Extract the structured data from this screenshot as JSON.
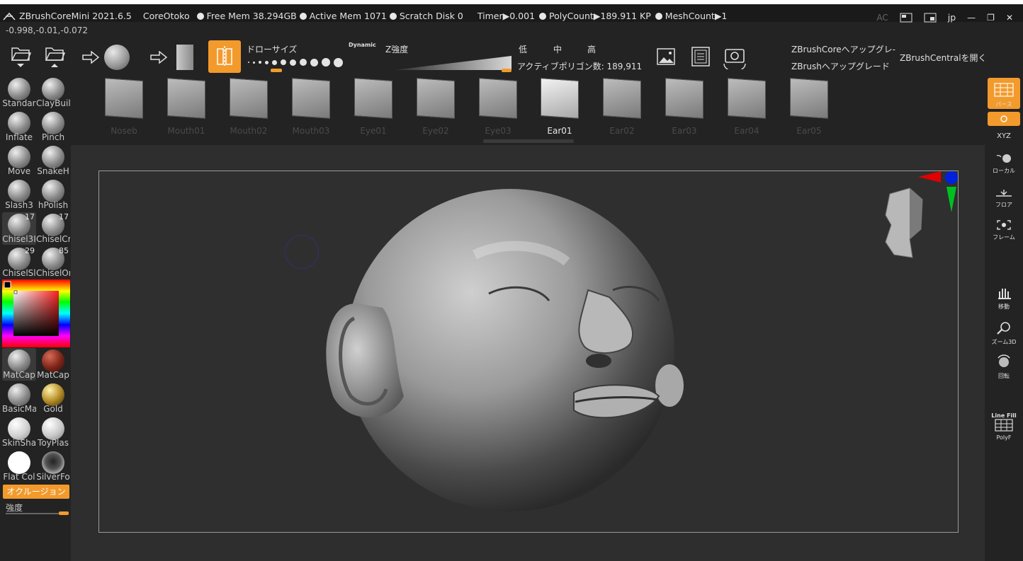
{
  "title_bar": {
    "app_title": "ZBrushCoreMini 2021.6.5",
    "project": "CoreOtoko",
    "free_mem": "Free Mem 38.294GB",
    "active_mem": "Active Mem 1071",
    "scratch_disk": "Scratch Disk 0",
    "timer": "Timer▶0.001",
    "polycount": "PolyCount▶189.911 KP",
    "meshcount": "MeshCount▶1",
    "ac": "AC",
    "lang": "jp"
  },
  "coords": "-0.998,-0.01,-0.072",
  "toolbar": {
    "draw_size_label": "ドローサイズ",
    "dynamic_label": "Dynamic",
    "draw_size_level": 3,
    "z_intensity_label": "Z強度",
    "z_intensity_value": 1.0,
    "level_low": "低",
    "level_mid": "中",
    "level_high": "高",
    "active_polygons": "アクティブポリゴン数: 189,911",
    "upgrade_core": "ZBrushCoreへアップグレ-",
    "upgrade_zbrush": "ZBrushへアップグレード",
    "open_central": "ZBrushCentralを開く"
  },
  "brush_shelf": {
    "items": [
      {
        "label": "Noseb",
        "icon": "nose-brush-icon"
      },
      {
        "label": "Mouth01",
        "icon": "mouth-brush-icon"
      },
      {
        "label": "Mouth02",
        "icon": "mouth-brush-icon"
      },
      {
        "label": "Mouth03",
        "icon": "mouth-brush-icon"
      },
      {
        "label": "Eye01",
        "icon": "eye-brush-icon"
      },
      {
        "label": "Eye02",
        "icon": "eye-brush-icon"
      },
      {
        "label": "Eye03",
        "icon": "eye-brush-icon"
      },
      {
        "label": "Ear01",
        "icon": "ear-brush-icon"
      },
      {
        "label": "Ear02",
        "icon": "ear-brush-icon"
      },
      {
        "label": "Ear03",
        "icon": "ear-brush-icon"
      },
      {
        "label": "Ear04",
        "icon": "ear-brush-icon"
      },
      {
        "label": "Ear05",
        "icon": "ear-brush-icon"
      }
    ],
    "active": "Ear01"
  },
  "left_panel": {
    "brushes": [
      {
        "label": "Standar"
      },
      {
        "label": "ClayBuil"
      },
      {
        "label": "Inflate"
      },
      {
        "label": "Pinch"
      },
      {
        "label": "Move"
      },
      {
        "label": "SnakeH"
      },
      {
        "label": "Slash3"
      },
      {
        "label": "hPolish"
      },
      {
        "label": "Chisel3I",
        "count": "17"
      },
      {
        "label": "ChiselCr",
        "count": "17"
      },
      {
        "label": "ChiselSl",
        "count": "29"
      },
      {
        "label": "ChiselOr",
        "count": "85"
      }
    ],
    "materials": [
      {
        "label": "MatCap"
      },
      {
        "label": "MatCap"
      },
      {
        "label": "BasicMa"
      },
      {
        "label": "Gold"
      },
      {
        "label": "SkinSha"
      },
      {
        "label": "ToyPlas"
      },
      {
        "label": "Flat Col"
      },
      {
        "label": "SilverFo"
      }
    ],
    "occlusion_label": "オクルージョン",
    "strength_label": "強度",
    "strength_value": 1.0
  },
  "right_panel": {
    "perspective": "パース",
    "xyz": "XYZ",
    "local": "ローカル",
    "floor": "フロア",
    "frame": "フレーム",
    "move": "移動",
    "zoom": "ズーム3D",
    "rotate": "回転",
    "line_fill": "Line Fill",
    "polyf": "PolyF"
  },
  "colors": {
    "accent": "#f39a2c",
    "panel_bg": "#232323",
    "canvas_bg": "#2e2e2e"
  }
}
